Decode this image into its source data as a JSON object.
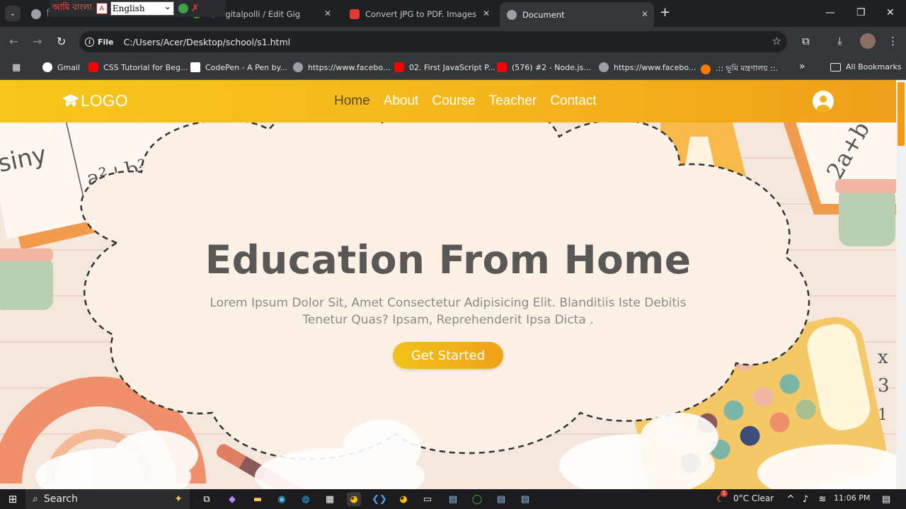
{
  "browser": {
    "tabs": [
      {
        "label": "দি",
        "favicon_color": "#9aa0a6"
      },
      {
        "label": "r / digitalpolli / Edit Gig",
        "favicon_color": "#43a047"
      },
      {
        "label": "Convert JPG to PDF. Images JPG",
        "favicon_color": "#e53935"
      },
      {
        "label": "Document",
        "favicon_color": "#9aa0a6",
        "active": true
      }
    ],
    "extension_bar": {
      "brand_red": "আমি",
      "brand_text": "বাংলা",
      "language": "English"
    },
    "address": {
      "scheme_chip": "File",
      "url": "C:/Users/Acer/Desktop/school/s1.html"
    },
    "bookmarks": [
      {
        "label": "Gmail",
        "color": "#ffffff"
      },
      {
        "label": "CSS Tutorial for Beg...",
        "color": "#ff0000"
      },
      {
        "label": "CodePen - A Pen by...",
        "color": "#ffffff"
      },
      {
        "label": "https://www.facebo...",
        "color": "#9aa0a6"
      },
      {
        "label": "02. First JavaScript P...",
        "color": "#ff0000"
      },
      {
        "label": "(576) #2 - Node.js...",
        "color": "#ff0000"
      },
      {
        "label": "https://www.facebo...",
        "color": "#9aa0a6"
      },
      {
        "label": ".:: ভূমি মন্ত্রণালয় ::.",
        "color": "#f57c00"
      }
    ],
    "all_bookmarks": "All Bookmarks"
  },
  "site": {
    "logo": "LOGO",
    "nav": [
      {
        "label": "Home",
        "current": true
      },
      {
        "label": "About"
      },
      {
        "label": "Course"
      },
      {
        "label": "Teacher"
      },
      {
        "label": "Contact"
      }
    ],
    "headline": "Education From Home",
    "subtext": "Lorem Ipsum Dolor Sit, Amet Consectetur Adipisicing Elit. Blanditiis Iste Debitis Tenetur Quas? Ipsam, Reprehenderit Ipsa Dicta .",
    "cta": "Get Started",
    "colors": {
      "accent": "#f3b21a",
      "heading": "#5a5856",
      "body_text": "#8b8986"
    }
  },
  "taskbar": {
    "search": "Search",
    "weather": "0°C  Clear",
    "time": "11:06 PM",
    "weather_badge": "1"
  }
}
